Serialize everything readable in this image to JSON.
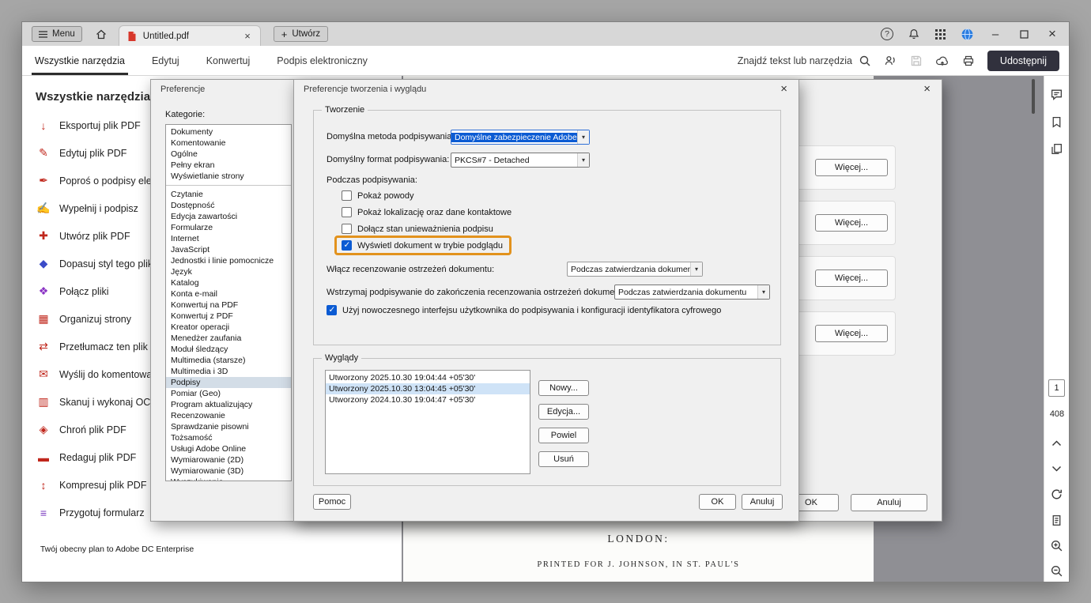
{
  "colors": {
    "share-bg": "#31313d",
    "selection-blue": "#0b5bd3",
    "highlight-orange": "#e2921d",
    "accent": "#2f6fd6"
  },
  "glyphs": {
    "close": "×",
    "plus": "+",
    "minimize": "–",
    "question": "?",
    "chevron": "▾"
  },
  "titlebar": {
    "menu_label": "Menu",
    "tab_title": "Untitled.pdf",
    "create_label": "Utwórz"
  },
  "toolbar": {
    "tabs": [
      {
        "label": "Wszystkie narzędzia",
        "active": true
      },
      {
        "label": "Edytuj"
      },
      {
        "label": "Konwertuj"
      },
      {
        "label": "Podpis elektroniczny"
      }
    ],
    "search_label": "Znajdź tekst lub narzędzia",
    "share_label": "Udostępnij"
  },
  "tools_panel": {
    "title": "Wszystkie narzędzia",
    "items": [
      {
        "label": "Eksportuj plik PDF",
        "icon": "↓",
        "color": "#c0271c"
      },
      {
        "label": "Edytuj plik PDF",
        "icon": "✎",
        "color": "#c0271c"
      },
      {
        "label": "Poproś o podpisy elektroniczne",
        "icon": "✒",
        "color": "#c0271c"
      },
      {
        "label": "Wypełnij i podpisz",
        "icon": "✍",
        "color": "#c0271c"
      },
      {
        "label": "Utwórz plik PDF",
        "icon": "✚",
        "color": "#c0271c"
      },
      {
        "label": "Dopasuj styl tego pliku",
        "icon": "◆",
        "color": "#3b4bc8"
      },
      {
        "label": "Połącz pliki",
        "icon": "❖",
        "color": "#8a33c4"
      },
      {
        "label": "Organizuj strony",
        "icon": "▦",
        "color": "#c0271c"
      },
      {
        "label": "Przetłumacz ten plik PDF",
        "icon": "⇄",
        "color": "#c0271c"
      },
      {
        "label": "Wyślij do komentowania",
        "icon": "✉",
        "color": "#c0271c"
      },
      {
        "label": "Skanuj i wykonaj OCR",
        "icon": "▥",
        "color": "#c0271c"
      },
      {
        "label": "Chroń plik PDF",
        "icon": "◈",
        "color": "#c0271c"
      },
      {
        "label": "Redaguj plik PDF",
        "icon": "▬",
        "color": "#c0271c"
      },
      {
        "label": "Kompresuj plik PDF",
        "icon": "↕",
        "color": "#c0271c"
      },
      {
        "label": "Przygotuj formularz",
        "icon": "≡",
        "color": "#7a3bbf"
      }
    ],
    "plan_text": "Twój obecny plan to Adobe DC Enterprise"
  },
  "preferences_dialog": {
    "title": "Preferencje",
    "categories_label": "Kategorie:",
    "categories": [
      {
        "label": "Dokumenty"
      },
      {
        "label": "Komentowanie"
      },
      {
        "label": "Ogólne"
      },
      {
        "label": "Pełny ekran"
      },
      {
        "label": "Wyświetlanie strony"
      },
      {
        "label": "Czytanie",
        "divider": true
      },
      {
        "label": "Dostępność"
      },
      {
        "label": "Edycja zawartości"
      },
      {
        "label": "Formularze"
      },
      {
        "label": "Internet"
      },
      {
        "label": "JavaScript"
      },
      {
        "label": "Jednostki i linie pomocnicze"
      },
      {
        "label": "Język"
      },
      {
        "label": "Katalog"
      },
      {
        "label": "Konta e-mail"
      },
      {
        "label": "Konwertuj na PDF"
      },
      {
        "label": "Konwertuj z PDF"
      },
      {
        "label": "Kreator operacji"
      },
      {
        "label": "Menedżer zaufania"
      },
      {
        "label": "Moduł śledzący"
      },
      {
        "label": "Multimedia (starsze)"
      },
      {
        "label": "Multimedia i 3D"
      },
      {
        "label": "Podpisy",
        "selected": true
      },
      {
        "label": "Pomiar (Geo)"
      },
      {
        "label": "Program aktualizujący"
      },
      {
        "label": "Recenzowanie"
      },
      {
        "label": "Sprawdzanie pisowni"
      },
      {
        "label": "Tożsamość"
      },
      {
        "label": "Usługi Adobe Online"
      },
      {
        "label": "Wymiarowanie (2D)"
      },
      {
        "label": "Wymiarowanie (3D)"
      },
      {
        "label": "Wyszukiwanie"
      }
    ],
    "more_button": "Więcej...",
    "ok": "OK",
    "cancel": "Anuluj"
  },
  "signing_dialog": {
    "title": "Preferencje tworzenia i wyglądu",
    "creation_group": {
      "legend": "Tworzenie",
      "method_label": "Domyślna metoda podpisywania:",
      "method_value": "Domyślne zabezpieczenie Adobe",
      "format_label": "Domyślny format podpisywania:",
      "format_value": "PKCS#7 - Detached",
      "when_signing_label": "Podczas podpisywania:",
      "checkboxes": [
        {
          "label": "Pokaż powody",
          "checked": false
        },
        {
          "label": "Pokaż lokalizację oraz dane kontaktowe",
          "checked": false
        },
        {
          "label": "Dołącz stan unieważnienia podpisu",
          "checked": false
        },
        {
          "label": "Wyświetl dokument w trybie podglądu",
          "checked": true,
          "highlighted": true
        }
      ],
      "review_label": "Włącz recenzowanie ostrzeżeń dokumentu:",
      "review_value": "Podczas zatwierdzania dokumentu",
      "pause_label": "Wstrzymaj podpisywanie do zakończenia recenzowania ostrzeżeń dokumentu:",
      "pause_value": "Podczas zatwierdzania dokumentu",
      "modern_ui_label": "Użyj nowoczesnego interfejsu użytkownika do podpisywania i konfiguracji identyfikatora cyfrowego",
      "modern_ui_checked": true
    },
    "appearance_group": {
      "legend": "Wyglądy",
      "items": [
        {
          "label": "Utworzony 2025.10.30 19:04:44 +05'30'"
        },
        {
          "label": "Utworzony 2025.10.30 13:04:45 +05'30'",
          "selected": true
        },
        {
          "label": "Utworzony 2024.10.30 19:04:47 +05'30'"
        }
      ],
      "buttons": [
        "Nowy...",
        "Edycja...",
        "Powiel",
        "Usuń"
      ]
    },
    "help": "Pomoc",
    "ok": "OK",
    "cancel": "Anuluj"
  },
  "document": {
    "line1": "LONDON:",
    "line2": "PRINTED FOR J. JOHNSON, IN ST. PAUL'S"
  },
  "page_nav": {
    "current": "1",
    "total": "408"
  }
}
